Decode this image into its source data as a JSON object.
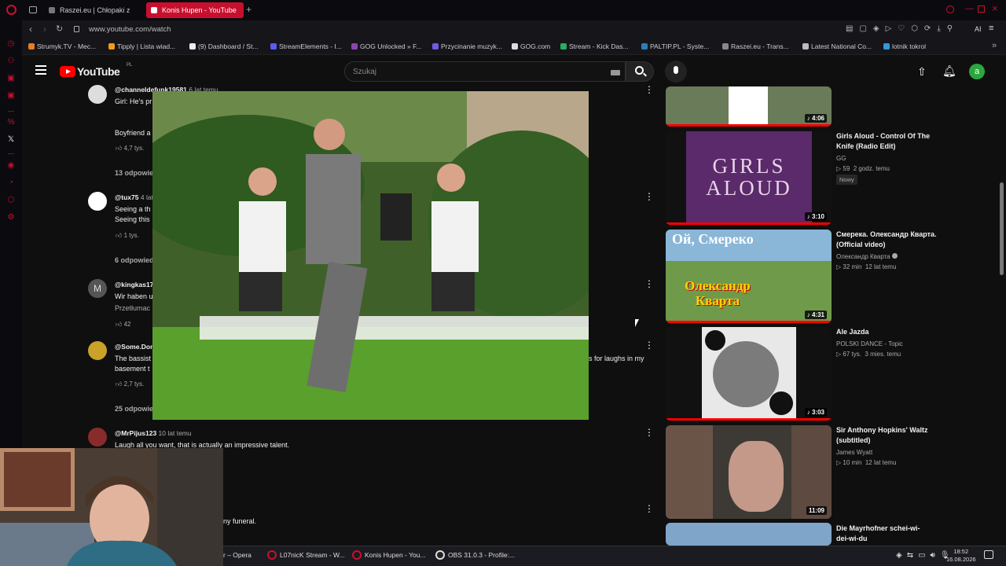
{
  "browser": {
    "tabs": [
      {
        "label": "Raszei.eu | Chłopaki z",
        "active": false
      },
      {
        "label": "Konis Hupen - YouTube",
        "active": true
      }
    ],
    "url": "www.youtube.com/watch",
    "bookmarks": [
      "Strumyk.TV - Mec...",
      "Tipply | Lista wiad...",
      "(9) Dashboard / St...",
      "StreamElements - I...",
      "GOG Unlocked » F...",
      "Przycinanie muzyk...",
      "GOG.com",
      "Stream - Kick Das...",
      "PALTIP.PL - Syste...",
      "Raszei.eu - Trans...",
      "Latest National Co...",
      "lotnik tokrol"
    ]
  },
  "youtube": {
    "logo": "YouTube",
    "country": "PL",
    "search_placeholder": "Szukaj",
    "avatar_letter": "a"
  },
  "comments": [
    {
      "author": "@channeldefunk19581",
      "time": "6 lat temu",
      "lines": [
        "Girl: He's pr",
        "",
        "Boyfriend a"
      ],
      "likes": "4,7 tys.",
      "replies": "13 odpowie"
    },
    {
      "author": "@tux75",
      "time": "4 lat",
      "lines": [
        "Seeing a th",
        "Seeing this"
      ],
      "likes": "1 tys.",
      "replies": "6 odpowied"
    },
    {
      "author": "@kingkas174",
      "time": "",
      "lines": [
        "Wir haben u",
        "Przetłumac"
      ],
      "likes": "42",
      "replies": ""
    },
    {
      "author": "@Some.Donk",
      "time": "",
      "lines": [
        "The bassist",
        "basement t"
      ],
      "likes": "2,7 tys.",
      "replies": "25 odpowie",
      "right_text": "s for laughs in my"
    },
    {
      "author": "@MrPijus123",
      "time": "10 lat temu",
      "lines": [
        "Laugh all you want, that is actually an impressive talent."
      ],
      "likes": "",
      "replies": ""
    },
    {
      "author": "",
      "time": "",
      "lines": [
        "ny funeral."
      ],
      "likes": "",
      "replies": ""
    }
  ],
  "recommendations": [
    {
      "title": "",
      "channel": "",
      "meta": "",
      "duration": "4:06"
    },
    {
      "title": "Girls Aloud - Control Of The Knife (Radio Edit)",
      "channel": "GG",
      "views": "59",
      "age": "2 godz. temu",
      "badge": "Nowy",
      "duration": "3:10",
      "thumb_text": "GIRLS ALOUD"
    },
    {
      "title": "Смерека. Олександр Кварта.(Official video)",
      "channel": "Олександр Кварта",
      "views": "32 min",
      "age": "12 lat temu",
      "duration": "4:31",
      "thumb_text_top": "Ой, Смереко",
      "thumb_text_bottom": "Олександр Кварта"
    },
    {
      "title": "Ale Jazda",
      "channel": "POLSKI DANCE - Topic",
      "views": "67 tys.",
      "age": "3 mies. temu",
      "duration": "3:03"
    },
    {
      "title": "Sir Anthony Hopkins' Waltz (subtitled)",
      "channel": "James Wyatt",
      "views": "10 min",
      "age": "12 lat temu",
      "duration": "11:09"
    },
    {
      "title": "Die Mayrhofner  schei-wi-dei-wi-du",
      "channel": "",
      "views": "",
      "age": "",
      "duration": ""
    }
  ],
  "taskbar": {
    "items": [
      "r – Opera",
      "L07nicK Stream - W...",
      "Konis Hupen - You...",
      "OBS 31.0.3 - Profile:..."
    ],
    "time": "18:52",
    "date": "16.08.2026"
  },
  "colors": {
    "accent": "#c8102e",
    "link": "#3ea6ff",
    "yt_red": "#ff0000"
  }
}
